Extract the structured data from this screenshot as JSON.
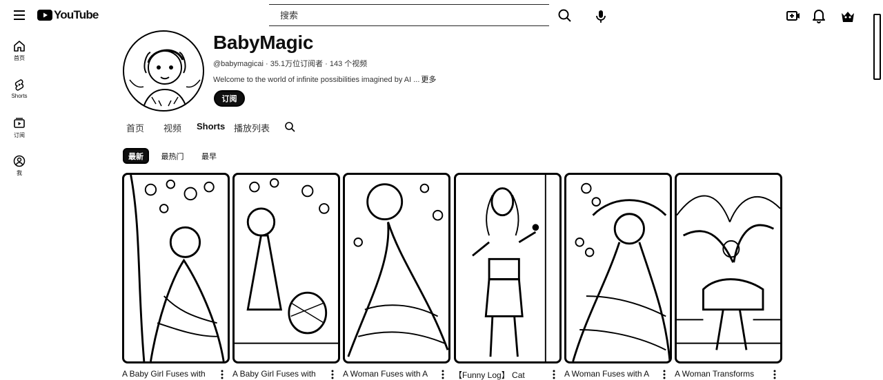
{
  "header": {
    "logo_text": "YouTube",
    "search_placeholder": "搜索",
    "icons": [
      "menu-icon",
      "search-icon",
      "mic-icon",
      "create-icon",
      "bell-icon",
      "avatar"
    ]
  },
  "guide": {
    "items": [
      {
        "label": "首页",
        "icon": "home-icon"
      },
      {
        "label": "Shorts",
        "icon": "shorts-icon"
      },
      {
        "label": "订阅",
        "icon": "subscriptions-icon"
      },
      {
        "label": "我",
        "icon": "you-icon"
      }
    ]
  },
  "channel": {
    "name": "BabyMagic",
    "meta": "@babymagicai · 35.1万位订阅者 · 143 个视频",
    "description": "Welcome to the world of infinite possibilities imagined by AI ...",
    "more_label": "更多",
    "subscribe_label": "订阅"
  },
  "tabs": [
    {
      "label": "首页",
      "active": false
    },
    {
      "label": "视频",
      "active": false
    },
    {
      "label": "Shorts",
      "active": true
    },
    {
      "label": "播放列表",
      "active": false
    }
  ],
  "chips": [
    {
      "label": "最新",
      "active": true
    },
    {
      "label": "最热门",
      "active": false
    },
    {
      "label": "最早",
      "active": false
    }
  ],
  "shorts": [
    {
      "title": "A Baby Girl Fuses with"
    },
    {
      "title": "A Baby Girl Fuses with"
    },
    {
      "title": "A Woman Fuses with A"
    },
    {
      "title": "【Funny Log】 Cat"
    },
    {
      "title": "A Woman Fuses with A"
    },
    {
      "title": "A Woman Transforms"
    }
  ],
  "colors": {
    "text": "#0f0f0f",
    "secondary_text": "#333333",
    "button_bg": "#0f0f0f",
    "background": "#ffffff"
  }
}
